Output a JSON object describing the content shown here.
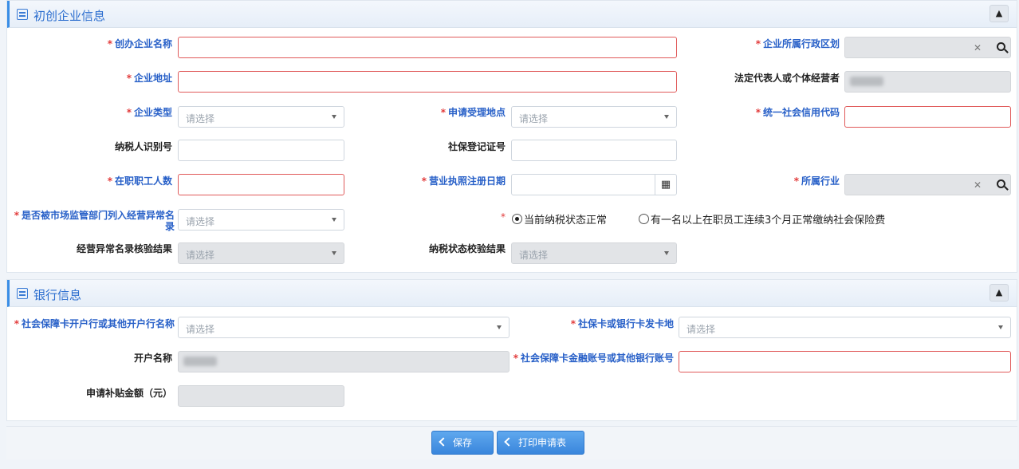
{
  "section1": {
    "title": "初创企业信息",
    "fields": {
      "company_name": "创办企业名称",
      "region": "企业所属行政区划",
      "address": "企业地址",
      "legal_rep": "法定代表人或个体经营者",
      "company_type": "企业类型",
      "apply_location": "申请受理地点",
      "credit_code": "统一社会信用代码",
      "taxpayer_id": "纳税人识别号",
      "social_security_no": "社保登记证号",
      "employees": "在职职工人数",
      "license_date": "营业执照注册日期",
      "industry": "所属行业",
      "abnormal_listed": "是否被市场监管部门列入经营异常名录",
      "abnormal_check": "经营异常名录核验结果",
      "tax_check": "纳税状态校验结果"
    },
    "placeholder": "请选择",
    "radio_normal": "当前纳税状态正常",
    "radio_insured": "有一名以上在职员工连续3个月正常缴纳社会保险费"
  },
  "section2": {
    "title": "银行信息",
    "fields": {
      "card_bank": "社会保障卡开户行或其他开户行名称",
      "card_issue_place": "社保卡或银行卡发卡地",
      "account_name": "开户名称",
      "account_no": "社会保障卡金融账号或其他银行账号",
      "subsidy_amount": "申请补贴金额（元）"
    },
    "placeholder": "请选择",
    "placeholder_alt": "请选择"
  },
  "buttons": {
    "save": "保存",
    "print": "打印申请表"
  },
  "icons": {
    "collapse": "▲",
    "clear": "✕",
    "calendar": "▦"
  }
}
